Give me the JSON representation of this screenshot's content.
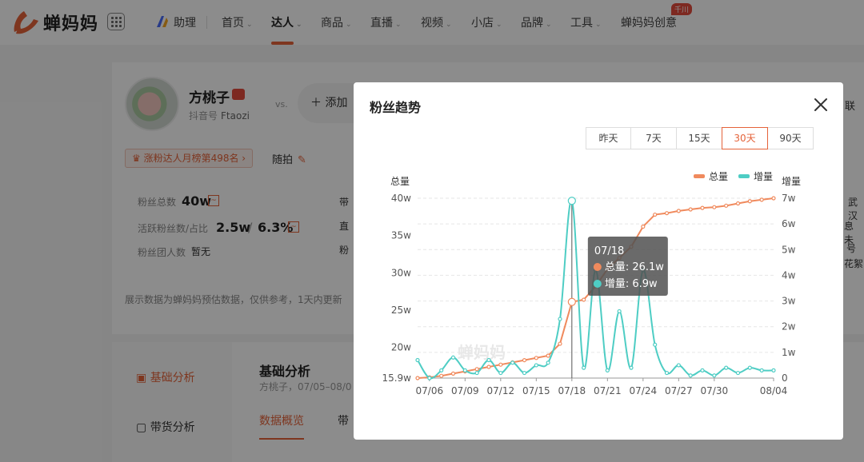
{
  "brand": {
    "name": "蝉妈妈",
    "accent": "#e5633a"
  },
  "nav": {
    "assistant": "助理",
    "items": [
      {
        "label": "首页",
        "chev": "⌄"
      },
      {
        "label": "达人",
        "chev": "⌄"
      },
      {
        "label": "商品",
        "chev": "⌄"
      },
      {
        "label": "直播",
        "chev": "⌄"
      },
      {
        "label": "视频",
        "chev": "⌄"
      },
      {
        "label": "小店",
        "chev": "⌄"
      },
      {
        "label": "品牌",
        "chev": "⌄"
      },
      {
        "label": "工具",
        "chev": "⌄"
      },
      {
        "label": "蝉妈妈创意",
        "chev": ""
      }
    ],
    "badge": "千川"
  },
  "profile": {
    "name": "方桃子",
    "douyin_label": "抖音号",
    "douyin_id": "Ftaozi",
    "vs": "vs.",
    "add_label": "添加",
    "rank_tag": "涨粉达人月榜第498名 ›",
    "suipai": "随拍",
    "stats": {
      "fans_label": "粉丝总数",
      "fans_value": "40w",
      "active_label": "活跃粉丝数/占比",
      "active_value": "2.5w",
      "active_sep": "/",
      "active_pct": "6.3%",
      "group_label": "粉丝团人数",
      "group_value": "暂无"
    },
    "col2": [
      "带",
      "直",
      "粉"
    ],
    "note": "展示数据为蝉妈妈预估数据，仅供参考，1天内更新",
    "right_fragments": [
      "联",
      "武汉",
      "息 未",
      "号",
      "花絮"
    ]
  },
  "sidebar": [
    {
      "label": "基础分析"
    },
    {
      "label": "带货分析"
    }
  ],
  "section": {
    "title": "基础分析",
    "subtitle": "方桃子，07/05–08/0",
    "tab_overview": "数据概览",
    "tab_next": "带"
  },
  "modal": {
    "title": "粉丝趋势",
    "ranges": [
      "昨天",
      "7天",
      "15天",
      "30天",
      "90天"
    ],
    "active_range": "30天"
  },
  "chart_data": {
    "type": "line",
    "x": [
      "07/05",
      "07/06",
      "07/07",
      "07/08",
      "07/09",
      "07/10",
      "07/11",
      "07/12",
      "07/13",
      "07/14",
      "07/15",
      "07/16",
      "07/17",
      "07/18",
      "07/19",
      "07/20",
      "07/21",
      "07/22",
      "07/23",
      "07/24",
      "07/25",
      "07/26",
      "07/27",
      "07/28",
      "07/29",
      "07/30",
      "07/31",
      "08/01",
      "08/02",
      "08/03",
      "08/04"
    ],
    "x_ticks": [
      "07/06",
      "07/09",
      "07/12",
      "07/15",
      "07/18",
      "07/21",
      "07/24",
      "07/27",
      "07/30",
      "08/04"
    ],
    "series": [
      {
        "name": "总量",
        "axis": "left",
        "color": "#f08a5d",
        "values": [
          15.9,
          16.0,
          16.2,
          16.5,
          16.8,
          17.1,
          17.4,
          17.7,
          18.0,
          18.3,
          18.6,
          18.9,
          20.5,
          26.1,
          26.4,
          28.2,
          30.5,
          32.0,
          33.5,
          36.2,
          37.8,
          38.0,
          38.3,
          38.5,
          38.7,
          38.8,
          39.0,
          39.3,
          39.6,
          39.8,
          40.0
        ]
      },
      {
        "name": "增量",
        "axis": "right",
        "color": "#4ecdc4",
        "values": [
          0.7,
          0,
          0.3,
          0.8,
          0.3,
          0.2,
          0.7,
          0.2,
          0.6,
          0.2,
          0.5,
          0.6,
          2.3,
          6.9,
          0.4,
          4.2,
          0.3,
          2.6,
          0.4,
          4.2,
          1.3,
          0.2,
          0.5,
          0.1,
          0.3,
          0.1,
          0.4,
          0.2,
          0.4,
          0.3,
          0.3
        ]
      }
    ],
    "ylabel_left": "总量",
    "ylabel_right": "增量",
    "y_left_ticks": [
      "15.9w",
      "20w",
      "25w",
      "30w",
      "35w",
      "40w"
    ],
    "y_left_range": [
      15.9,
      40
    ],
    "y_right_ticks": [
      "0",
      "1w",
      "2w",
      "3w",
      "4w",
      "5w",
      "6w",
      "7w"
    ],
    "y_right_range": [
      0,
      7
    ],
    "legend_position": "top-right",
    "watermark": "蝉妈妈",
    "tooltip": {
      "date": "07/18",
      "total_label": "总量",
      "total_value": "26.1w",
      "inc_label": "增量",
      "inc_value": "6.9w"
    }
  }
}
